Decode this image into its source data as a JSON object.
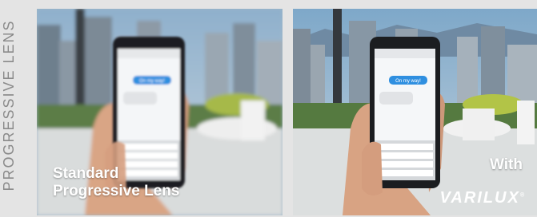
{
  "side_label": "PROGRESSIVE LENS",
  "left_panel": {
    "caption_line1": "Standard",
    "caption_line2": "Progressive Lens",
    "bubble_text": "On my way!",
    "style": "blurred"
  },
  "right_panel": {
    "caption": "With",
    "brand": "VARILUX",
    "bubble_text": "On my way!",
    "style": "sharp"
  },
  "colors": {
    "page_bg": "#e4e4e4",
    "side_label": "#8a8a8a",
    "sky": "#9fb7c8",
    "bubble": "#2f8fe0",
    "caption": "#ffffff"
  }
}
